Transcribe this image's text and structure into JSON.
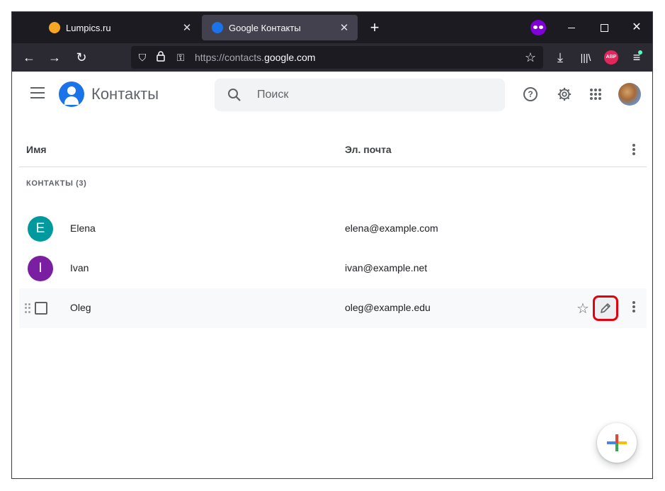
{
  "browser": {
    "tabs": [
      {
        "title": "Lumpics.ru",
        "favicon_color": "#f5a623"
      },
      {
        "title": "Google Контакты",
        "favicon_color": "#1a73e8"
      }
    ],
    "url_prefix": "https://contacts.",
    "url_domain": "google.com",
    "abp_label": "ABP"
  },
  "app": {
    "title": "Контакты",
    "search_placeholder": "Поиск"
  },
  "columns": {
    "name": "Имя",
    "email": "Эл. почта"
  },
  "section_label": "КОНТАКТЫ (3)",
  "contacts": [
    {
      "initial": "E",
      "name": "Elena",
      "email": "elena@example.com",
      "avatar_color": "#00999e"
    },
    {
      "initial": "I",
      "name": "Ivan",
      "email": "ivan@example.net",
      "avatar_color": "#7b1fa2"
    },
    {
      "initial": "",
      "name": "Oleg",
      "email": "oleg@example.edu",
      "avatar_color": ""
    }
  ],
  "colors": {
    "highlight": "#e3000f",
    "brand": "#1a73e8"
  }
}
